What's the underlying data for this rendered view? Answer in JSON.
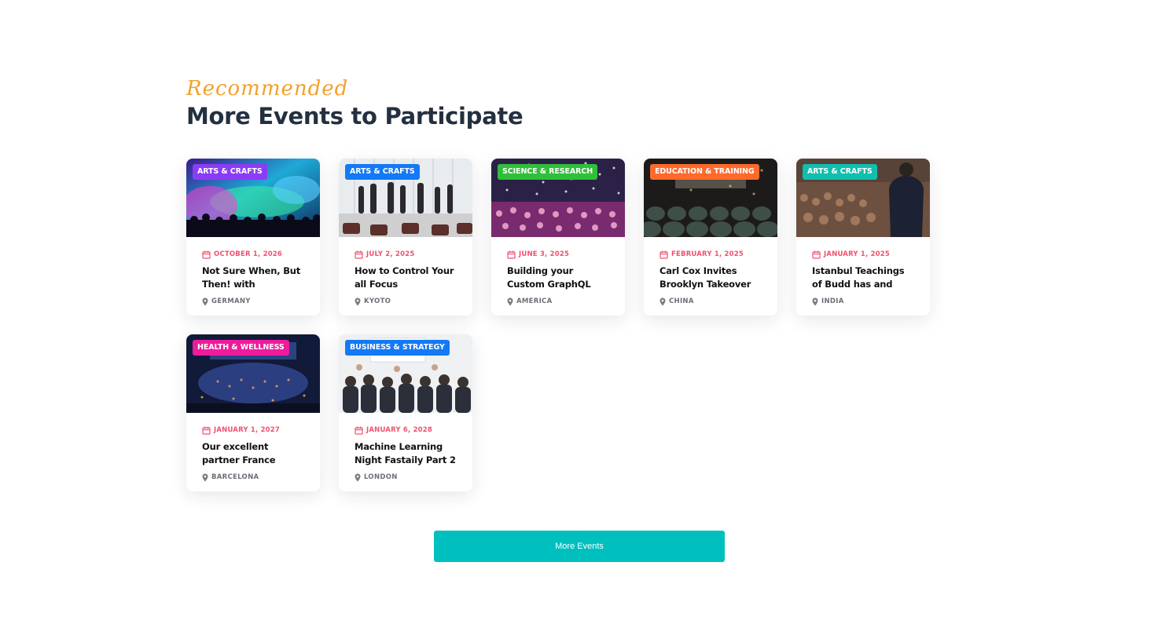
{
  "section": {
    "eyebrow": "Recommended",
    "title": "More Events to Participate"
  },
  "events": [
    {
      "category": "ARTS & CRAFTS",
      "badge_color": "#8b3cf7",
      "date": "OCTOBER 1, 2026",
      "title": "Not Sure When, But Then! with",
      "location": "GERMANY",
      "image": "concert-lights"
    },
    {
      "category": "ARTS & CRAFTS",
      "badge_color": "#1479f5",
      "date": "JULY 2, 2025",
      "title": "How to Control Your all Focus",
      "location": "KYOTO",
      "image": "networking-room"
    },
    {
      "category": "SCIENCE & RESEARCH",
      "badge_color": "#2fbf3a",
      "date": "JUNE 3, 2025",
      "title": "Building your Custom GraphQL Tooling for",
      "location": "AMERICA",
      "image": "confetti-crowd"
    },
    {
      "category": "EDUCATION & TRAINING",
      "badge_color": "#ff6a2b",
      "date": "FEBRUARY 1, 2025",
      "title": "Carl Cox Invites Brooklyn Takeover all",
      "location": "CHINA",
      "image": "auditorium-seats"
    },
    {
      "category": "ARTS & CRAFTS",
      "badge_color": "#10bfae",
      "date": "JANUARY 1, 2025",
      "title": "Istanbul Teachings of Budd has and",
      "location": "INDIA",
      "image": "speaker-audience"
    },
    {
      "category": "HEALTH & WELLNESS",
      "badge_color": "#ee1b9c",
      "date": "JANUARY 1, 2027",
      "title": "Our excellent partner France Pavillion",
      "location": "BARCELONA",
      "image": "arena"
    },
    {
      "category": "BUSINESS & STRATEGY",
      "badge_color": "#1479f5",
      "date": "JANUARY 6, 2028",
      "title": "Machine Learning Night Fastaily Part 2",
      "location": "LONDON",
      "image": "seminar-audience"
    }
  ],
  "more_button": {
    "label": "More Events"
  },
  "colors": {
    "accent": "#00bfbf",
    "eyebrow": "#f2a12c",
    "date": "#f0506e",
    "heading": "#23303f"
  },
  "icons": {
    "date": "calendar-icon",
    "location": "map-pin-icon"
  }
}
